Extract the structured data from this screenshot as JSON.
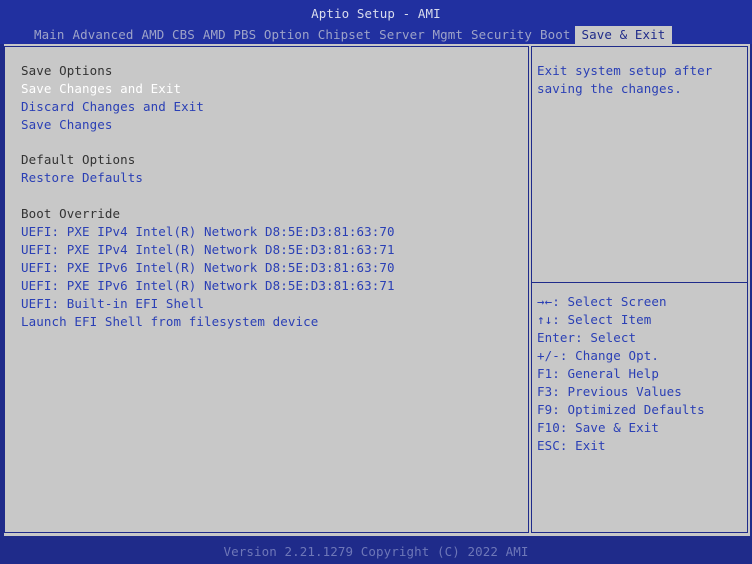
{
  "app_title": "Aptio Setup - AMI",
  "tabs": [
    {
      "label": "Main"
    },
    {
      "label": "Advanced"
    },
    {
      "label": "AMD CBS"
    },
    {
      "label": "AMD PBS Option"
    },
    {
      "label": "Chipset"
    },
    {
      "label": "Server Mgmt"
    },
    {
      "label": "Security"
    },
    {
      "label": "Boot"
    },
    {
      "label": "Save & Exit"
    }
  ],
  "active_tab": "Save & Exit",
  "sections": {
    "save_options": {
      "title": "Save Options",
      "items": [
        "Save Changes and Exit",
        "Discard Changes and Exit",
        "Save Changes"
      ]
    },
    "default_options": {
      "title": "Default Options",
      "items": [
        "Restore Defaults"
      ]
    },
    "boot_override": {
      "title": "Boot Override",
      "items": [
        "UEFI: PXE IPv4 Intel(R) Network D8:5E:D3:81:63:70",
        "UEFI: PXE IPv4 Intel(R) Network D8:5E:D3:81:63:71",
        "UEFI: PXE IPv6 Intel(R) Network D8:5E:D3:81:63:70",
        "UEFI: PXE IPv6 Intel(R) Network D8:5E:D3:81:63:71",
        "UEFI: Built-in EFI Shell",
        "Launch EFI Shell from filesystem device"
      ]
    }
  },
  "selected_item": "Save Changes and Exit",
  "help": {
    "description": [
      "Exit system setup after",
      "saving the changes."
    ],
    "keys": [
      "→←: Select Screen",
      "↑↓: Select Item",
      "Enter: Select",
      "+/-: Change Opt.",
      "F1: General Help",
      "F3: Previous Values",
      "F9: Optimized Defaults",
      "F10: Save & Exit",
      "ESC: Exit"
    ]
  },
  "footer": {
    "version": "Version 2.21.1279 Copyright (C) 2022 AMI"
  },
  "colors": {
    "background": "#1f2b8a",
    "panel": "#c8c8c8",
    "link_text": "#2a3fb5",
    "selected_text": "#ffffff"
  }
}
